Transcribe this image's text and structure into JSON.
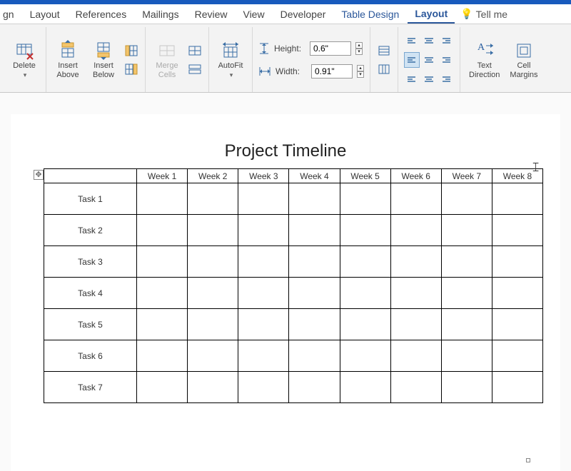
{
  "tabs": {
    "items": [
      {
        "label": "gn",
        "partial": true
      },
      {
        "label": "Layout"
      },
      {
        "label": "References"
      },
      {
        "label": "Mailings"
      },
      {
        "label": "Review"
      },
      {
        "label": "View"
      },
      {
        "label": "Developer"
      },
      {
        "label": "Table Design",
        "context": true
      },
      {
        "label": "Layout",
        "context": true,
        "active": true
      }
    ],
    "tellme_label": "Tell me"
  },
  "ribbon": {
    "delete_label": "Delete",
    "insert_above_label": "Insert\nAbove",
    "insert_below_label": "Insert\nBelow",
    "merge_label": "Merge\nCells",
    "autofit_label": "AutoFit",
    "height_label": "Height:",
    "height_value": "0.6\"",
    "width_label": "Width:",
    "width_value": "0.91\"",
    "text_direction_label": "Text\nDirection",
    "cell_margins_label": "Cell\nMargins"
  },
  "document": {
    "title": "Project Timeline",
    "columns": [
      "",
      "Week 1",
      "Week 2",
      "Week 3",
      "Week 4",
      "Week 5",
      "Week 6",
      "Week 7",
      "Week 8"
    ],
    "rows": [
      "Task 1",
      "Task 2",
      "Task 3",
      "Task 4",
      "Task 5",
      "Task 6",
      "Task 7"
    ]
  }
}
